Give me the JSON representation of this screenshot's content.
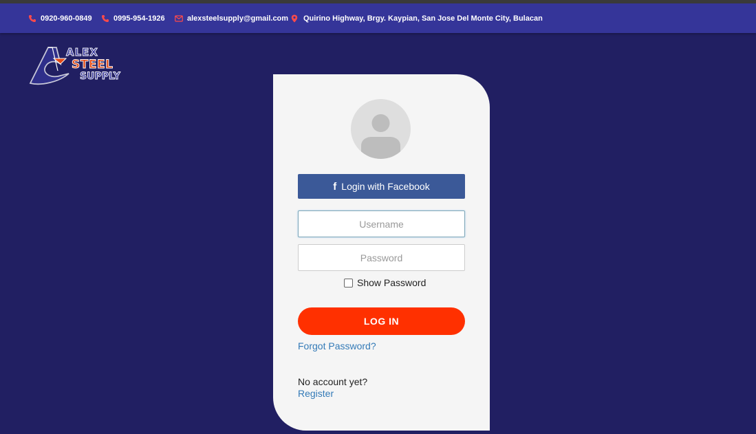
{
  "topbar": {
    "phone1": "0920-960-0849",
    "phone2": "0995-954-1926",
    "email": "alexsteelsupply@gmail.com",
    "address": "Quirino Highway, Brgy. Kaypian, San Jose Del Monte City, Bulacan"
  },
  "logo": {
    "line1": "ALEX",
    "line2": "STEEL",
    "line3": "SUPPLY"
  },
  "login": {
    "facebook_label": "Login with Facebook",
    "username_placeholder": "Username",
    "password_placeholder": "Password",
    "show_password_label": "Show Password",
    "login_button": "LOG IN",
    "forgot_password": "Forgot Password?",
    "no_account": "No account yet?",
    "register": "Register"
  },
  "colors": {
    "background": "#211f62",
    "topbar": "#353599",
    "icon_red": "#ff4a4a",
    "facebook": "#3b5998",
    "login_button": "#ff3000",
    "link": "#337ab7"
  }
}
